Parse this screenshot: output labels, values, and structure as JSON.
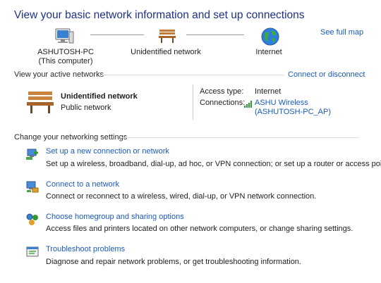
{
  "header": {
    "title": "View your basic network information and set up connections",
    "see_full_map": "See full map"
  },
  "map": {
    "computer_name": "ASHUTOSH-PC",
    "computer_sub": "(This computer)",
    "network_name": "Unidentified network",
    "internet_label": "Internet"
  },
  "active": {
    "section_label": "View your active networks",
    "connect_link": "Connect or disconnect",
    "network_name": "Unidentified network",
    "network_type": "Public network",
    "access_type_label": "Access type:",
    "access_type_value": "Internet",
    "connections_label": "Connections:",
    "connection_line1": "ASHU Wireless",
    "connection_line2": "(ASHUTOSH-PC_AP)"
  },
  "settings": {
    "section_label": "Change your networking settings",
    "tasks": [
      {
        "title": "Set up a new connection or network",
        "desc": "Set up a wireless, broadband, dial-up, ad hoc, or VPN connection; or set up a router or access point.",
        "icon": "new-connection-icon"
      },
      {
        "title": "Connect to a network",
        "desc": "Connect or reconnect to a wireless, wired, dial-up, or VPN network connection.",
        "icon": "connect-network-icon"
      },
      {
        "title": "Choose homegroup and sharing options",
        "desc": "Access files and printers located on other network computers, or change sharing settings.",
        "icon": "homegroup-icon"
      },
      {
        "title": "Troubleshoot problems",
        "desc": "Diagnose and repair network problems, or get troubleshooting information.",
        "icon": "troubleshoot-icon"
      }
    ]
  },
  "colors": {
    "title": "#1e3287",
    "link": "#1a5bb8",
    "bench": "#b5763a"
  }
}
